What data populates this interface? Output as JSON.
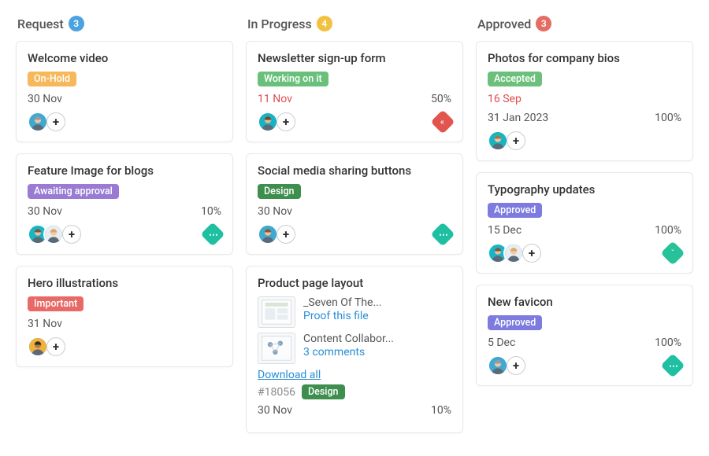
{
  "columns": [
    {
      "title": "Request",
      "count": "3",
      "count_color": "#4aa3e0",
      "cards": [
        {
          "title": "Welcome video",
          "status": {
            "label": "On-Hold",
            "bg": "#f6b85a"
          },
          "date": "30 Nov",
          "avatars": [
            {
              "bg": "#3fa9d2",
              "hair": "#9a9a9a",
              "skin": "#f1c6a6"
            }
          ],
          "add": "+"
        },
        {
          "title": "Feature Image for blogs",
          "status": {
            "label": "Awaiting approval",
            "bg": "#9a7bd4"
          },
          "date": "30 Nov",
          "progress": "10%",
          "avatars": [
            {
              "bg": "#16b6c6",
              "hair": "#7a5a3a",
              "skin": "#eebd9a"
            },
            {
              "bg": "#e9edf2",
              "hair": "#d9a86b",
              "skin": "#f3cba7"
            }
          ],
          "add": "+",
          "priority": {
            "type": "normal",
            "glyph": "⋯"
          }
        },
        {
          "title": "Hero illustrations",
          "status": {
            "label": "Important",
            "bg": "#e86a66"
          },
          "date": "31 Nov",
          "avatars": [
            {
              "bg": "#f1b23b",
              "hair": "#2f2a22",
              "skin": "#b07a4a"
            }
          ],
          "add": "+"
        }
      ]
    },
    {
      "title": "In Progress",
      "count": "4",
      "count_color": "#f2c13f",
      "cards": [
        {
          "title": "Newsletter sign-up form",
          "status": {
            "label": "Working on it",
            "bg": "#69c07a"
          },
          "date": "11 Nov",
          "date_class": "overdue",
          "progress": "50%",
          "avatars": [
            {
              "bg": "#15b3c3",
              "hair": "#6c4a2f",
              "skin": "#eab78e"
            }
          ],
          "add": "+",
          "priority": {
            "type": "critical",
            "glyph": "«"
          }
        },
        {
          "title": "Social media sharing buttons",
          "status": {
            "label": "Design",
            "bg": "#3e8e4e"
          },
          "date": "30 Nov",
          "avatars": [
            {
              "bg": "#3fa9d2",
              "hair": "#8a5a2f",
              "skin": "#efc39a"
            }
          ],
          "add": "+",
          "priority": {
            "type": "normal",
            "glyph": "⋯"
          }
        },
        {
          "title": "Product page layout",
          "attachments": [
            {
              "name": "_Seven Of The...",
              "action": "Proof this file"
            },
            {
              "name": "Content Collabor...",
              "action": "3 comments"
            }
          ],
          "download": "Download all",
          "id": "#18056",
          "status_inline": {
            "label": "Design",
            "bg": "#3e8e4e"
          },
          "date": "30 Nov",
          "progress": "10%"
        }
      ]
    },
    {
      "title": "Approved",
      "count": "3",
      "count_color": "#e66c64",
      "cards": [
        {
          "title": "Photos for company bios",
          "status": {
            "label": "Accepted",
            "bg": "#6cc07c"
          },
          "date": "16 Sep",
          "date_class": "overdue",
          "date2": "31 Jan 2023",
          "progress": "100%",
          "avatars": [
            {
              "bg": "#19b4c4",
              "hair": "#9a7a4a",
              "skin": "#f0c7a0"
            }
          ],
          "add": "+"
        },
        {
          "title": "Typography updates",
          "status": {
            "label": "Approved",
            "bg": "#7d7be0"
          },
          "date": "15 Dec",
          "progress": "100%",
          "avatars": [
            {
              "bg": "#16b6c6",
              "hair": "#7a5a3a",
              "skin": "#eebd9a"
            },
            {
              "bg": "#e9edf2",
              "hair": "#d9a86b",
              "skin": "#f3cba7"
            }
          ],
          "add": "+",
          "priority": {
            "type": "low",
            "glyph": "ˇ"
          }
        },
        {
          "title": "New favicon",
          "status": {
            "label": "Approved",
            "bg": "#7d7be0"
          },
          "date": "5 Dec",
          "progress": "100%",
          "avatars": [
            {
              "bg": "#3fa9d2",
              "hair": "#9a9a9a",
              "skin": "#f1c6a6"
            }
          ],
          "add": "+",
          "priority": {
            "type": "normal",
            "glyph": "⋯"
          }
        }
      ]
    }
  ]
}
